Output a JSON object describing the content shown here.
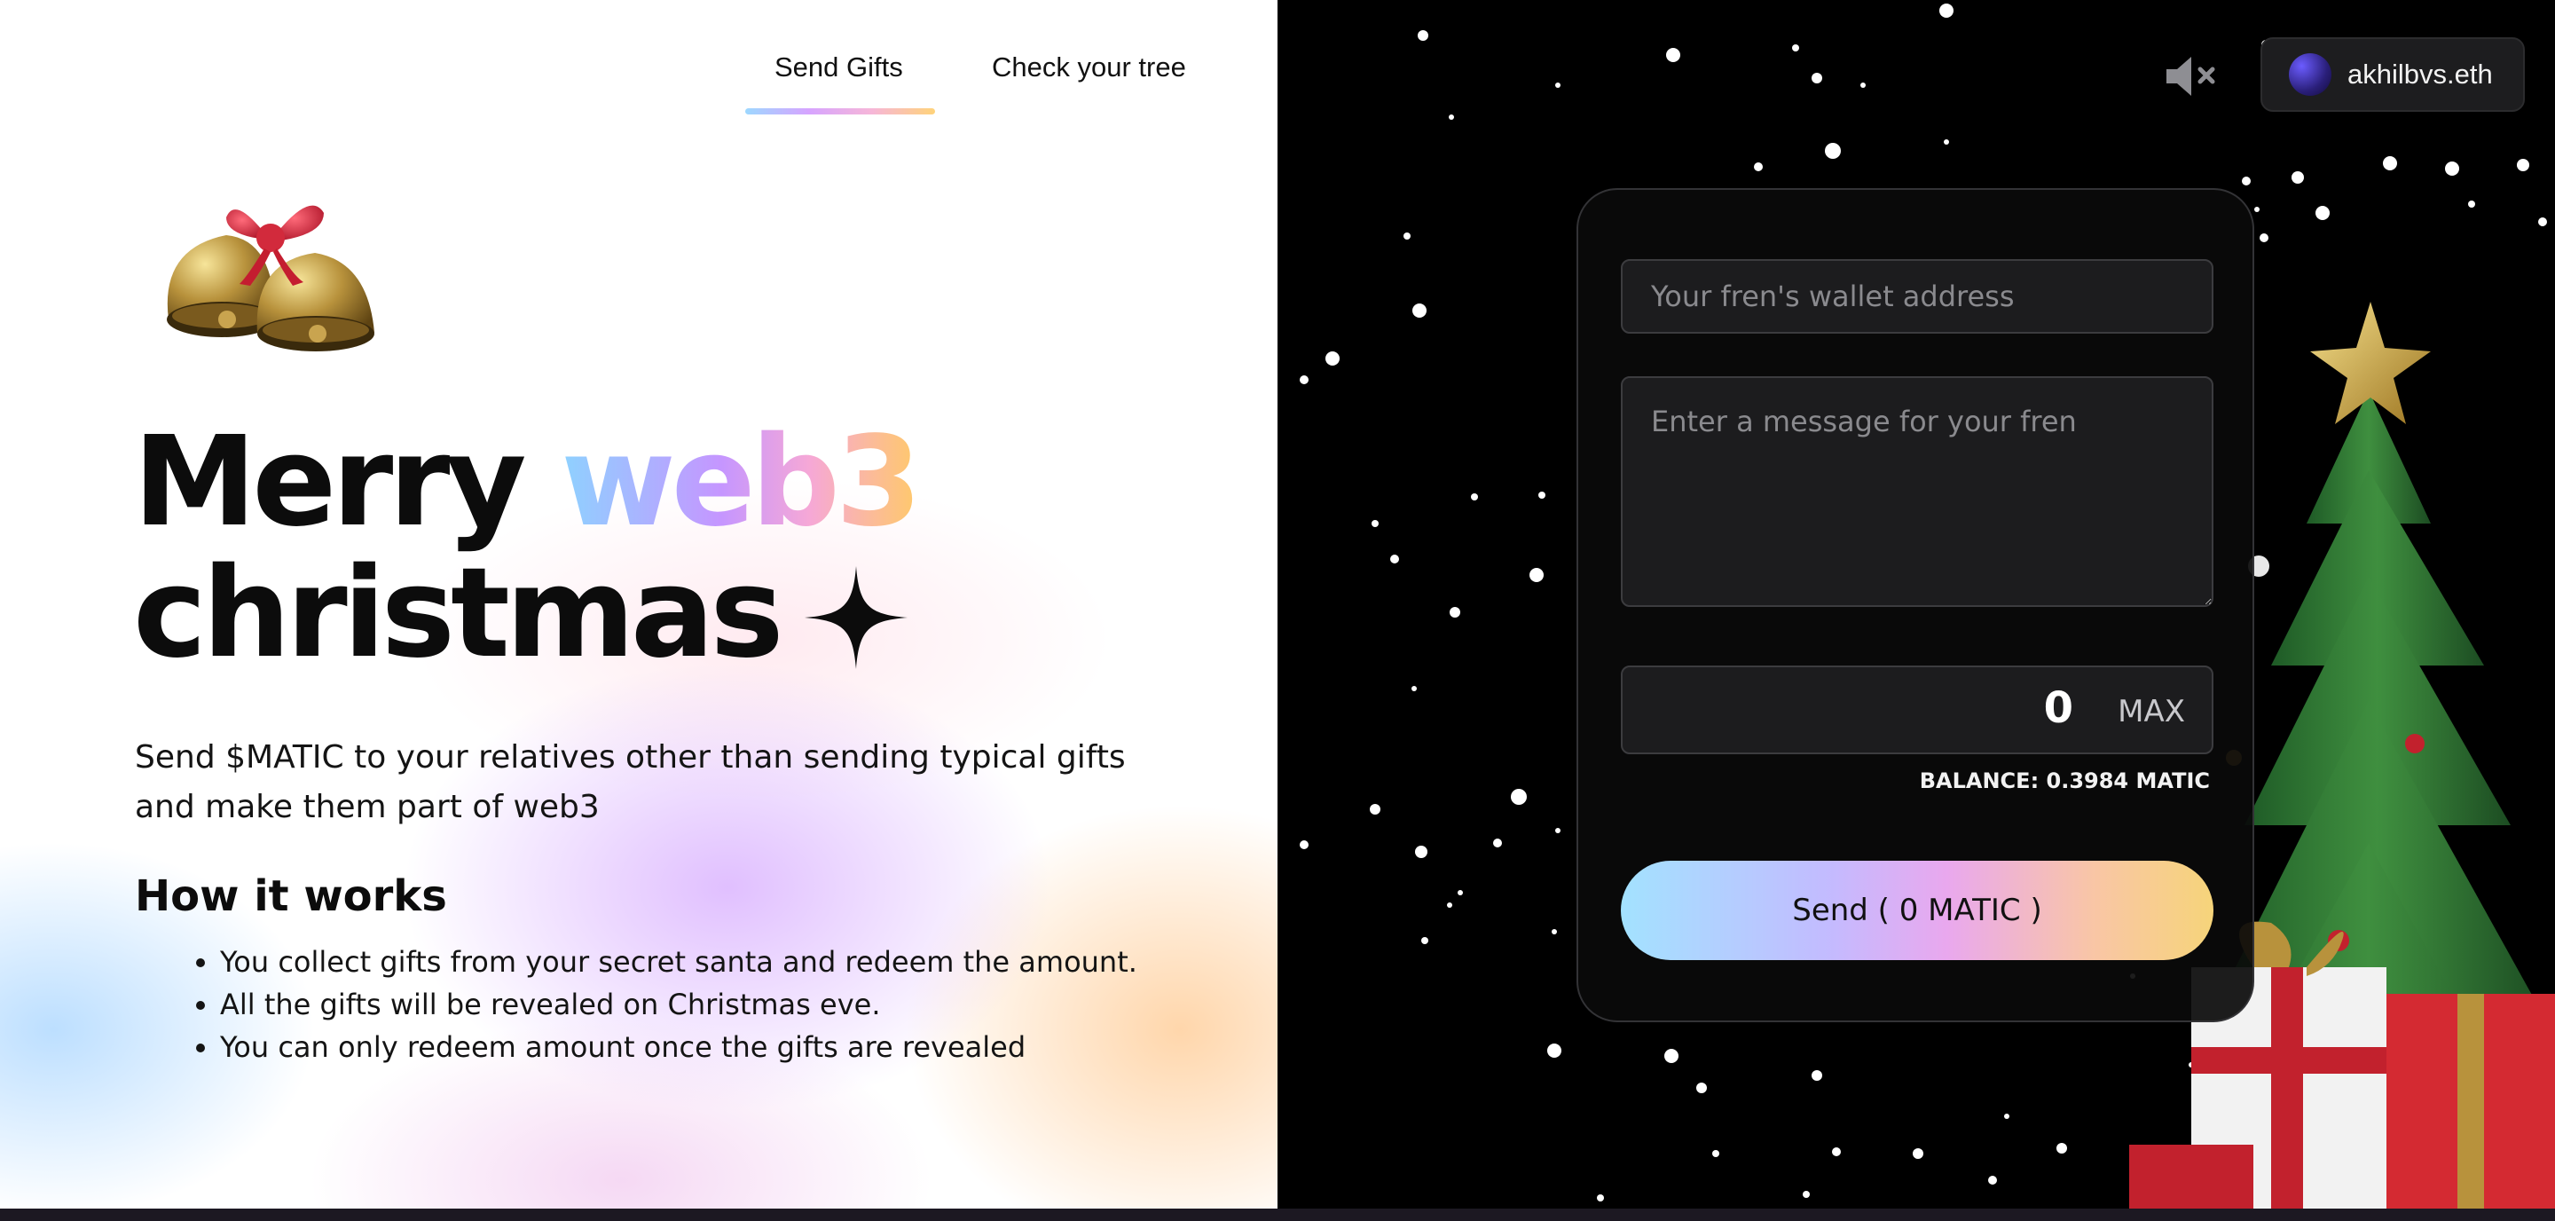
{
  "nav": {
    "tabs": [
      {
        "label": "Send Gifts",
        "active": true
      },
      {
        "label": "Check your tree",
        "active": false
      }
    ]
  },
  "hero": {
    "line1_start": "Merry ",
    "line1_accent": "web3",
    "line2": "christmas",
    "subtitle": "Send $MATIC to your relatives other than sending typical gifts and make them part of web3"
  },
  "how_it_works": {
    "heading": "How it works",
    "items": [
      "You collect gifts from your secret santa and redeem the amount.",
      "All the gifts will be revealed on Christmas eve.",
      "You can only redeem amount once the gifts are revealed"
    ]
  },
  "header_right": {
    "sound_icon": "speaker-muted-icon",
    "wallet_name": "akhilbvs.eth"
  },
  "form": {
    "address_placeholder": "Your fren's wallet address",
    "message_placeholder": "Enter a message for your fren",
    "amount": "0",
    "max_label": "MAX",
    "balance": "BALANCE: 0.3984 MATIC",
    "send_label": "Send ( 0 MATIC )"
  },
  "colors": {
    "accent_gradient": [
      "#8ed2ff",
      "#c596ff",
      "#f6a8d6",
      "#ffc96b"
    ],
    "panel_bg": "#000000",
    "field_bg": "#1c1c1e"
  }
}
